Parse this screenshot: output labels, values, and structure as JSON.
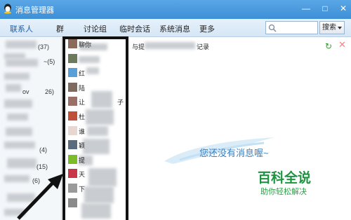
{
  "window": {
    "title": "消息管理器",
    "min": "—",
    "max": "□",
    "close": "✕"
  },
  "tabs": [
    {
      "label": "联系人"
    },
    {
      "label": "群"
    },
    {
      "label": "讨论组"
    },
    {
      "label": "临时会话"
    },
    {
      "label": "系统消息"
    },
    {
      "label": "更多"
    }
  ],
  "search": {
    "placeholder": "",
    "button_label": "搜索"
  },
  "groups": [
    {
      "count": "(37)"
    },
    {
      "count": "~(5)"
    },
    {
      "count": "ov"
    },
    {
      "count": "26)"
    },
    {
      "count": "(4)"
    },
    {
      "count": "(15)"
    },
    {
      "count": "(6)"
    }
  ],
  "contacts": [
    {
      "name": "聊你",
      "color": "#8a6a5a"
    },
    {
      "name": "",
      "color": "#6c7a5a"
    },
    {
      "name": "红",
      "color": "#5aa0d8"
    },
    {
      "name": "陆",
      "color": "#7f6a60"
    },
    {
      "name": "让",
      "color": "#9a6f68",
      "suffix": "子"
    },
    {
      "name": "杜",
      "color": "#c0503a"
    },
    {
      "name": "谁",
      "color": "#e7d7d0"
    },
    {
      "name": "颖",
      "color": "#5b6b7e"
    },
    {
      "name": "提",
      "color": "#7cbc2a"
    },
    {
      "name": "天",
      "color": "#c8364a"
    },
    {
      "name": "下",
      "color": "#9a9a9a"
    },
    {
      "name": "",
      "color": "#8a8a8a"
    }
  ],
  "main": {
    "record_prefix": "与提",
    "record_suffix": "记录",
    "empty_message": "您还没有消息喔~",
    "refresh_icon": "↻",
    "delete_icon": "✕"
  },
  "watermark": {
    "title": "百科全说",
    "subtitle": "助你轻松解决"
  },
  "colors": {
    "titlebar": "#3d8fd6",
    "accent": "#1f5fb0",
    "brand": "#1e9440"
  }
}
